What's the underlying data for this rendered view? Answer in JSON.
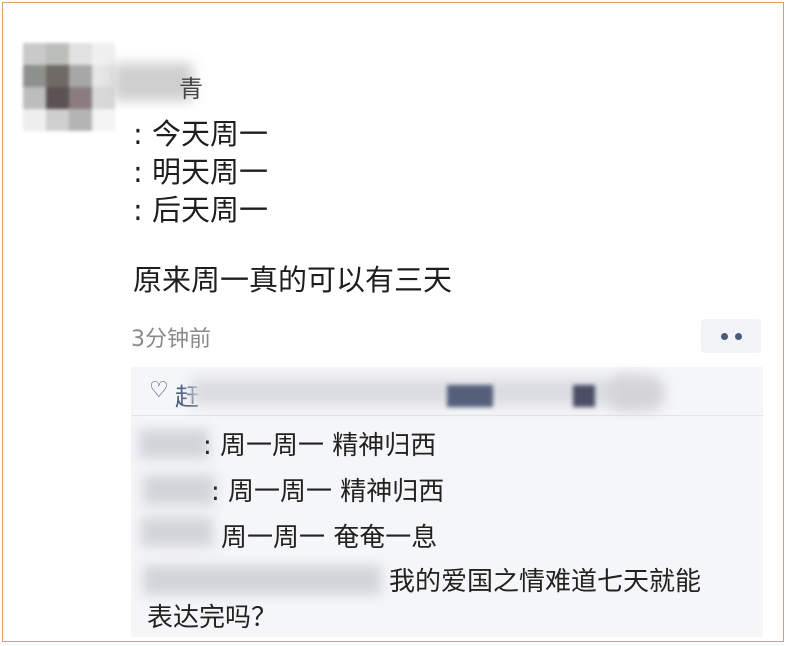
{
  "post": {
    "name_tail": "青",
    "lines": [
      ": 今天周一",
      ": 明天周一",
      ": 后天周一"
    ],
    "body": "原来周一真的可以有三天",
    "time": "3分钟前"
  },
  "likes": {
    "first_char": "赶"
  },
  "comments": [
    {
      "text": ": 周一周一  精神归西"
    },
    {
      "text": ": 周一周一  精神归西"
    },
    {
      "text": "周一周一 奄奄一息"
    },
    {
      "text": "我的爱国之情难道七天就能",
      "text_cont": "表达完吗？"
    }
  ],
  "icons": [
    "heart-icon",
    "more-icon"
  ],
  "colors": {
    "link": "#4a5a7a",
    "time": "#8a8a8a",
    "comment_bg": "#f5f6f8",
    "border": "#d9a066"
  }
}
